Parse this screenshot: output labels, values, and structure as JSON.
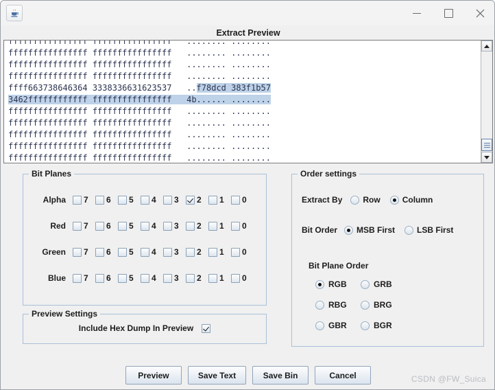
{
  "window": {
    "app_icon": "java-coffee-cup-icon",
    "minimize_label": "Minimize",
    "maximize_label": "Maximize",
    "close_label": "Close",
    "dialog_title": "Extract Preview"
  },
  "hex_preview": {
    "lines": [
      {
        "hex1": "ffffffffffffffff",
        "hex2": "ffffffffffffffff",
        "ascii1": "........",
        "ascii2": "........",
        "highlight": "none"
      },
      {
        "hex1": "ffffffffffffffff",
        "hex2": "ffffffffffffffff",
        "ascii1": "........",
        "ascii2": "........",
        "highlight": "none"
      },
      {
        "hex1": "ffffffffffffffff",
        "hex2": "ffffffffffffffff",
        "ascii1": "........",
        "ascii2": "........",
        "highlight": "none"
      },
      {
        "hex1": "ffffffffffffffff",
        "hex2": "ffffffffffffffff",
        "ascii1": "........",
        "ascii2": "........",
        "highlight": "none"
      },
      {
        "hex1": "ffff663738646364",
        "hex2": "3338336631623537",
        "ascii1": "..f78dcd",
        "ascii2": "383f1b57",
        "highlight": "ascii"
      },
      {
        "hex1": "3462ffffffffffff",
        "hex2": "ffffffffffffffff",
        "ascii1": "4b......",
        "ascii2": "........",
        "highlight": "full"
      },
      {
        "hex1": "ffffffffffffffff",
        "hex2": "ffffffffffffffff",
        "ascii1": "........",
        "ascii2": "........",
        "highlight": "none"
      },
      {
        "hex1": "ffffffffffffffff",
        "hex2": "ffffffffffffffff",
        "ascii1": "........",
        "ascii2": "........",
        "highlight": "none"
      },
      {
        "hex1": "ffffffffffffffff",
        "hex2": "ffffffffffffffff",
        "ascii1": "........",
        "ascii2": "........",
        "highlight": "none"
      },
      {
        "hex1": "ffffffffffffffff",
        "hex2": "ffffffffffffffff",
        "ascii1": "........",
        "ascii2": "........",
        "highlight": "none"
      },
      {
        "hex1": "ffffffffffffffff",
        "hex2": "ffffffffffffffff",
        "ascii1": "........",
        "ascii2": "........",
        "highlight": "none"
      },
      {
        "hex1": "ffffffffffffffff",
        "hex2": "ffffffffffffffff",
        "ascii1": "........",
        "ascii2": "........",
        "highlight": "none"
      }
    ],
    "scrollbar": {
      "up_icon": "triangle-up-icon",
      "down_icon": "triangle-down-icon",
      "thumb": "scroll-thumb"
    }
  },
  "bit_planes": {
    "legend": "Bit Planes",
    "bit_labels": [
      "7",
      "6",
      "5",
      "4",
      "3",
      "2",
      "1",
      "0"
    ],
    "channels": [
      {
        "name": "Alpha",
        "checked": [
          false,
          false,
          false,
          false,
          false,
          true,
          false,
          false
        ]
      },
      {
        "name": "Red",
        "checked": [
          false,
          false,
          false,
          false,
          false,
          false,
          false,
          false
        ]
      },
      {
        "name": "Green",
        "checked": [
          false,
          false,
          false,
          false,
          false,
          false,
          false,
          false
        ]
      },
      {
        "name": "Blue",
        "checked": [
          false,
          false,
          false,
          false,
          false,
          false,
          false,
          false
        ]
      }
    ]
  },
  "order_settings": {
    "legend": "Order settings",
    "extract_by": {
      "label": "Extract By",
      "options": [
        "Row",
        "Column"
      ],
      "selected": "Column"
    },
    "bit_order": {
      "label": "Bit Order",
      "options": [
        "MSB First",
        "LSB First"
      ],
      "selected": "MSB First"
    },
    "bit_plane_order": {
      "label": "Bit Plane Order",
      "options": [
        "RGB",
        "GRB",
        "RBG",
        "BRG",
        "GBR",
        "BGR"
      ],
      "selected": "RGB"
    }
  },
  "preview_settings": {
    "legend": "Preview Settings",
    "include_hex_dump_label": "Include Hex Dump In Preview",
    "include_hex_dump_checked": true
  },
  "buttons": [
    {
      "label": "Preview"
    },
    {
      "label": "Save Text"
    },
    {
      "label": "Save Bin"
    },
    {
      "label": "Cancel"
    }
  ],
  "watermark": "CSDN @FW_Suica"
}
